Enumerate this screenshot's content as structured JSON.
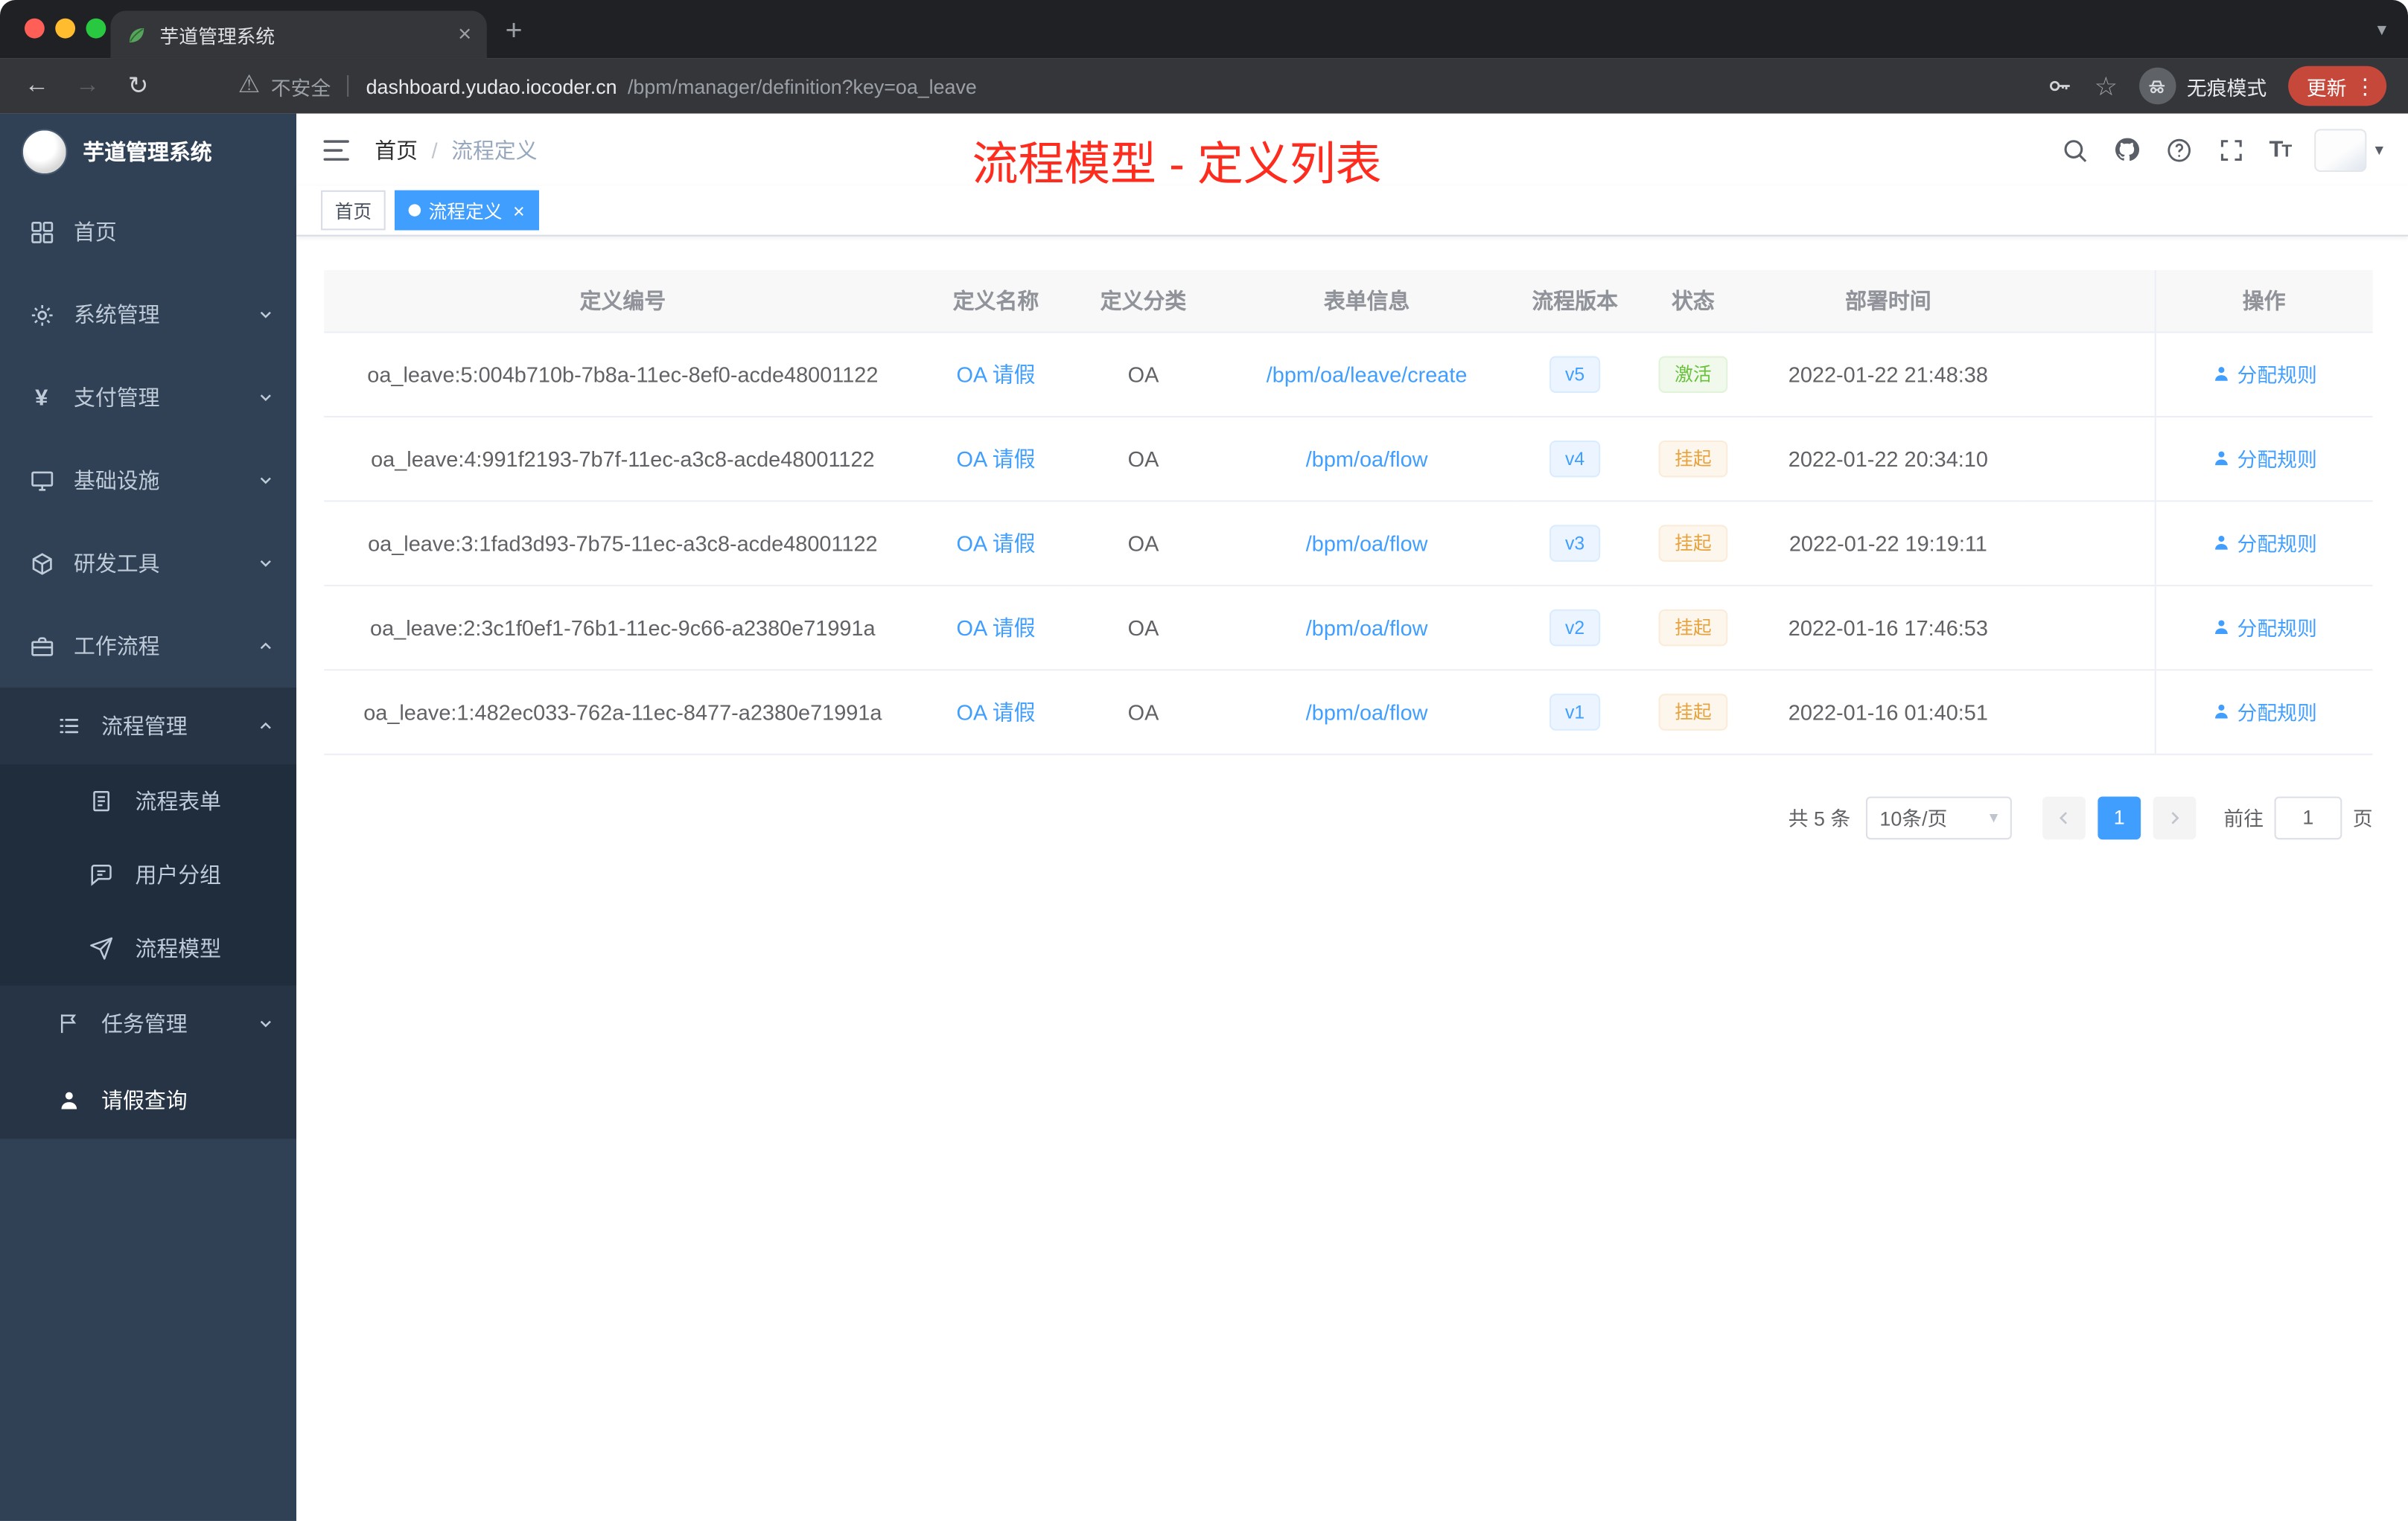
{
  "colors": {
    "accent_blue": "#409eff",
    "sidebar_bg": "#304156",
    "sidebar_sub_bg": "#263445",
    "sidebar_sub3_bg": "#1f2d3d",
    "annotation_red": "#fe2c1e",
    "status_success": "#67c23a",
    "status_warning": "#e6a23c",
    "chrome_dark": "#202124",
    "chrome_toolbar": "#35363a",
    "update_pill": "#c5483b"
  },
  "icons": {
    "close": "×",
    "plus": "+",
    "overflow": "⋮",
    "caret": "▾",
    "back": "←",
    "forward": "→",
    "reload": "↻",
    "star": "☆",
    "warning": "⚠",
    "yen": "¥"
  },
  "browser": {
    "tab_title": "芋道管理系统",
    "security_label": "不安全",
    "url_domain": "dashboard.yudao.iocoder.cn",
    "url_path": "/bpm/manager/definition?key=oa_leave",
    "incognito_label": "无痕模式",
    "update_label": "更新"
  },
  "sidebar": {
    "app_title": "芋道管理系统",
    "menu": [
      {
        "label": "首页"
      },
      {
        "label": "系统管理"
      },
      {
        "label": "支付管理"
      },
      {
        "label": "基础设施"
      },
      {
        "label": "研发工具"
      },
      {
        "label": "工作流程"
      }
    ],
    "process_group": {
      "label": "流程管理"
    },
    "process_children": [
      {
        "label": "流程表单"
      },
      {
        "label": "用户分组"
      },
      {
        "label": "流程模型"
      }
    ],
    "task_item": {
      "label": "任务管理"
    },
    "leave_item": {
      "label": "请假查询"
    }
  },
  "header": {
    "breadcrumb": [
      "首页",
      "流程定义"
    ],
    "breadcrumb_separator": "/",
    "annotation": "流程模型 - 定义列表"
  },
  "tags": [
    {
      "label": "首页"
    },
    {
      "label": "流程定义"
    }
  ],
  "table": {
    "columns": [
      "定义编号",
      "定义名称",
      "定义分类",
      "表单信息",
      "流程版本",
      "状态",
      "部署时间",
      "操作"
    ],
    "rows": [
      {
        "id": "oa_leave:5:004b710b-7b8a-11ec-8ef0-acde48001122",
        "name": "OA 请假",
        "category": "OA",
        "form": "/bpm/oa/leave/create",
        "version": "v5",
        "status": "激活",
        "status_type": "success",
        "time": "2022-01-22 21:48:38",
        "action": "分配规则"
      },
      {
        "id": "oa_leave:4:991f2193-7b7f-11ec-a3c8-acde48001122",
        "name": "OA 请假",
        "category": "OA",
        "form": "/bpm/oa/flow",
        "version": "v4",
        "status": "挂起",
        "status_type": "warning",
        "time": "2022-01-22 20:34:10",
        "action": "分配规则"
      },
      {
        "id": "oa_leave:3:1fad3d93-7b75-11ec-a3c8-acde48001122",
        "name": "OA 请假",
        "category": "OA",
        "form": "/bpm/oa/flow",
        "version": "v3",
        "status": "挂起",
        "status_type": "warning",
        "time": "2022-01-22 19:19:11",
        "action": "分配规则"
      },
      {
        "id": "oa_leave:2:3c1f0ef1-76b1-11ec-9c66-a2380e71991a",
        "name": "OA 请假",
        "category": "OA",
        "form": "/bpm/oa/flow",
        "version": "v2",
        "status": "挂起",
        "status_type": "warning",
        "time": "2022-01-16 17:46:53",
        "action": "分配规则"
      },
      {
        "id": "oa_leave:1:482ec033-762a-11ec-8477-a2380e71991a",
        "name": "OA 请假",
        "category": "OA",
        "form": "/bpm/oa/flow",
        "version": "v1",
        "status": "挂起",
        "status_type": "warning",
        "time": "2022-01-16 01:40:51",
        "action": "分配规则"
      }
    ]
  },
  "pagination": {
    "total_label": "共 5 条",
    "page_size": "10条/页",
    "current_page": "1",
    "goto_label": "前往",
    "goto_value": "1",
    "page_unit": "页"
  }
}
